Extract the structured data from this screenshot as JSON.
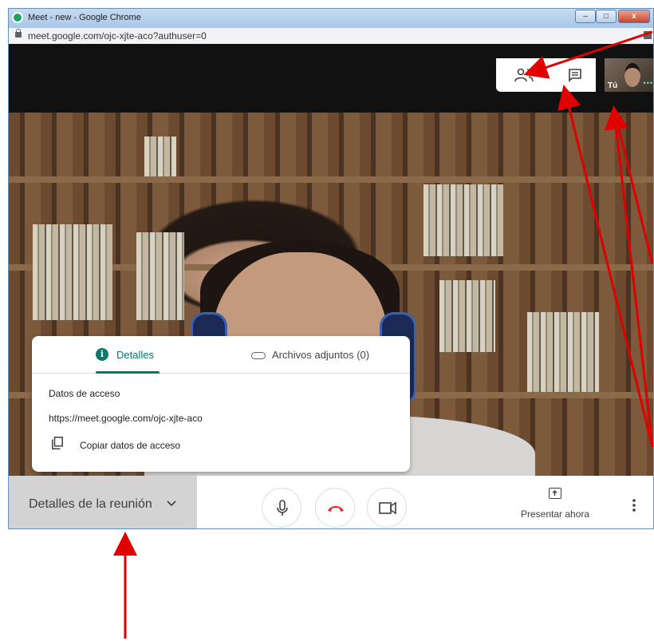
{
  "window": {
    "title": "Meet - new - Google Chrome",
    "controls": {
      "minimize": "–",
      "maximize": "□",
      "close": "x"
    }
  },
  "addressbar": {
    "url": "meet.google.com/ojc-xjte-aco?authuser=0"
  },
  "participants": {
    "self_label": "Tú",
    "self_speaking_dots": "•••"
  },
  "details_card": {
    "tabs": [
      {
        "label": "Detalles",
        "icon": "info-icon",
        "active": true
      },
      {
        "label": "Archivos adjuntos (0)",
        "icon": "paperclip-icon",
        "active": false
      }
    ],
    "access_title": "Datos de acceso",
    "access_url": "https://meet.google.com/ojc-xjte-aco",
    "copy_label": "Copiar datos de acceso"
  },
  "bottombar": {
    "details_label": "Detalles de la reunión",
    "present_label": "Presentar ahora"
  },
  "colors": {
    "accent": "#00796b",
    "end_call": "#d93025",
    "annotation_arrows": "#e00000"
  }
}
